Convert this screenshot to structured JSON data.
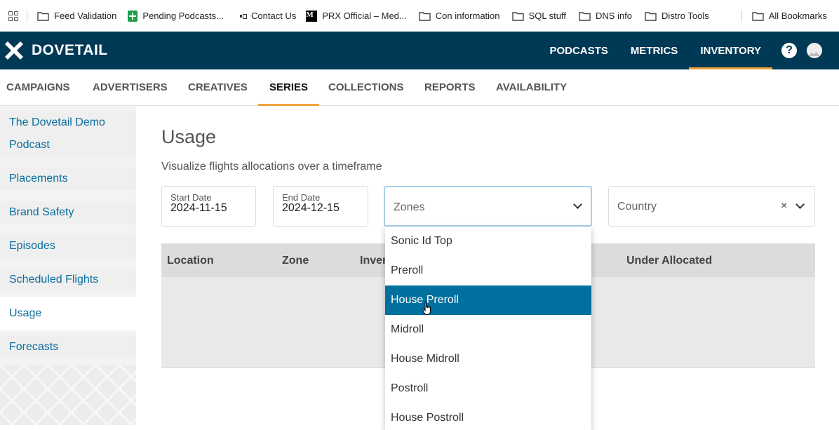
{
  "bookmarks": [
    {
      "label": "Feed Validation",
      "icon": "folder-icon"
    },
    {
      "label": "Pending Podcasts...",
      "icon": "sheets-icon"
    },
    {
      "label": "Contact Us",
      "icon": "prx-icon"
    },
    {
      "label": "PRX Official – Med...",
      "icon": "m-icon"
    },
    {
      "label": "Con information",
      "icon": "folder-icon"
    },
    {
      "label": "SQL stuff",
      "icon": "folder-icon"
    },
    {
      "label": "DNS info",
      "icon": "folder-icon"
    },
    {
      "label": "Distro Tools",
      "icon": "folder-icon"
    }
  ],
  "all_bookmarks": "All Bookmarks",
  "app": {
    "name": "DOVETAIL",
    "nav": [
      "PODCASTS",
      "METRICS",
      "INVENTORY"
    ],
    "active_nav": "INVENTORY",
    "help_icon": "?"
  },
  "subnav": {
    "items": [
      "CAMPAIGNS",
      "ADVERTISERS",
      "CREATIVES",
      "SERIES",
      "COLLECTIONS",
      "REPORTS",
      "AVAILABILITY"
    ],
    "active": "SERIES"
  },
  "sidebar": {
    "title_line1": "The Dovetail Demo",
    "title_line2": "Podcast",
    "items": [
      "Placements",
      "Brand Safety",
      "Episodes",
      "Scheduled Flights",
      "Usage",
      "Forecasts"
    ],
    "active": "Usage"
  },
  "main": {
    "title": "Usage",
    "description": "Visualize flights allocations over a timeframe",
    "start_date_label": "Start Date",
    "start_date": "2024-11-15",
    "end_date_label": "End Date",
    "end_date": "2024-12-15",
    "zones_placeholder": "Zones",
    "country_placeholder": "Country",
    "clear_symbol": "×"
  },
  "table": {
    "headers": [
      "Location",
      "Zone",
      "Inver",
      "Under Allocated"
    ]
  },
  "zones_dropdown": {
    "options": [
      "Sonic Id Top",
      "Preroll",
      "House Preroll",
      "Midroll",
      "House Midroll",
      "Postroll",
      "House Postroll"
    ],
    "highlighted": "House Preroll"
  },
  "colors": {
    "appbar": "#003955",
    "accent": "#f0a33b",
    "link": "#0a6d9e",
    "highlight": "#00709e"
  }
}
